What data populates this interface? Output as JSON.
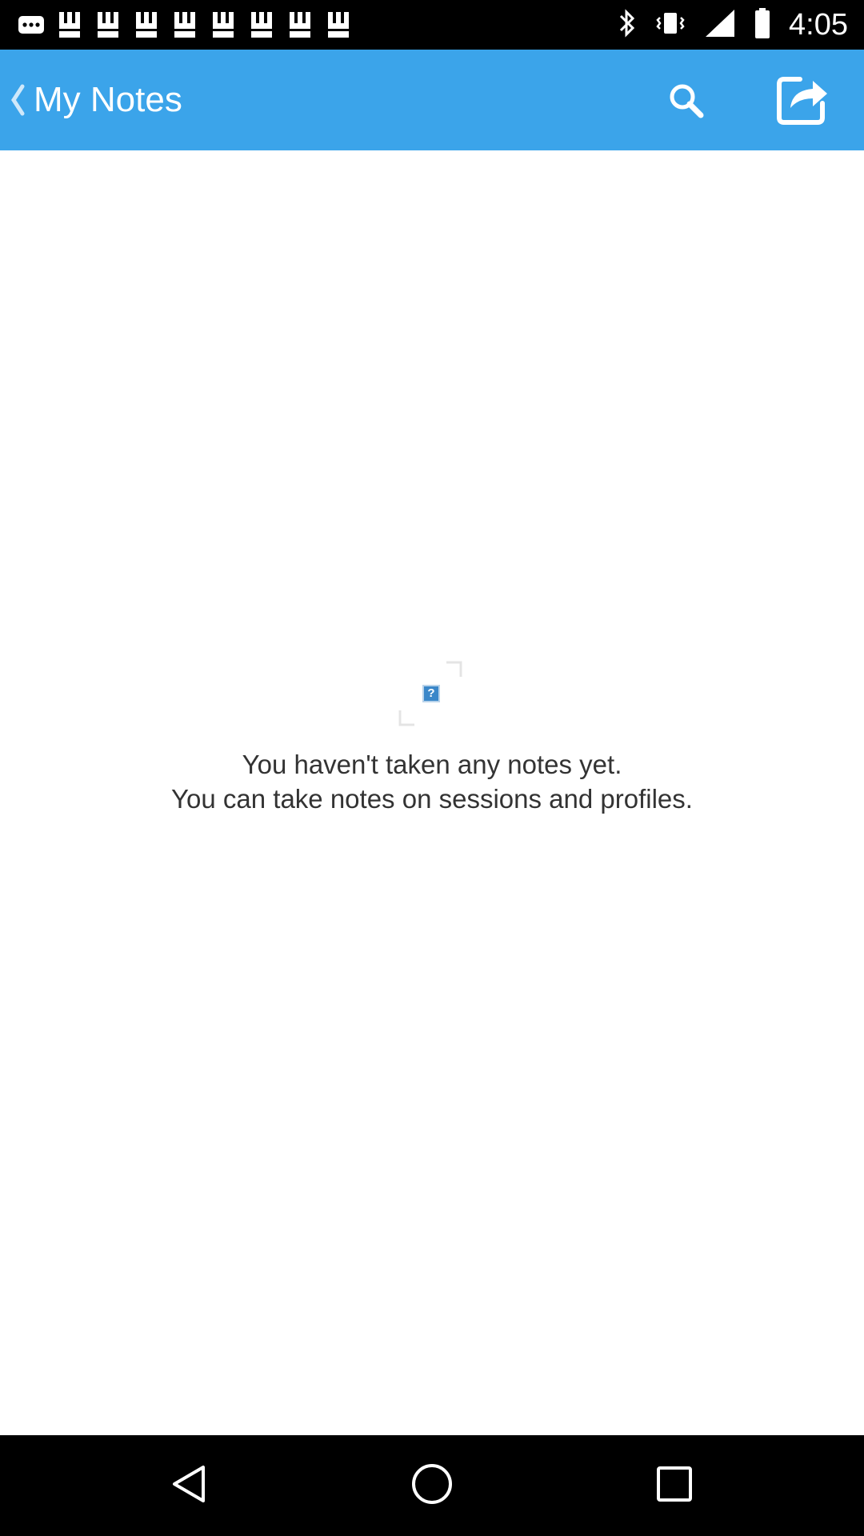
{
  "status_bar": {
    "time": "4:05",
    "notification_icons": [
      "more-icon",
      "image-icon",
      "image-icon",
      "image-icon",
      "image-icon",
      "image-icon",
      "image-icon",
      "image-icon",
      "image-icon"
    ],
    "indicators": [
      "bluetooth-icon",
      "vibrate-icon",
      "signal-icon",
      "battery-icon"
    ]
  },
  "app_bar": {
    "title": "My Notes",
    "back_icon": "chevron-left-icon",
    "search_icon": "search-icon",
    "share_icon": "share-icon",
    "color": "#3ba4ea"
  },
  "empty_state": {
    "line1": "You haven't taken any notes yet.",
    "line2": "You can take notes on sessions and profiles.",
    "icon_glyph": "?"
  },
  "nav_bar": {
    "buttons": [
      "back-triangle-icon",
      "home-circle-icon",
      "recents-square-icon"
    ]
  }
}
